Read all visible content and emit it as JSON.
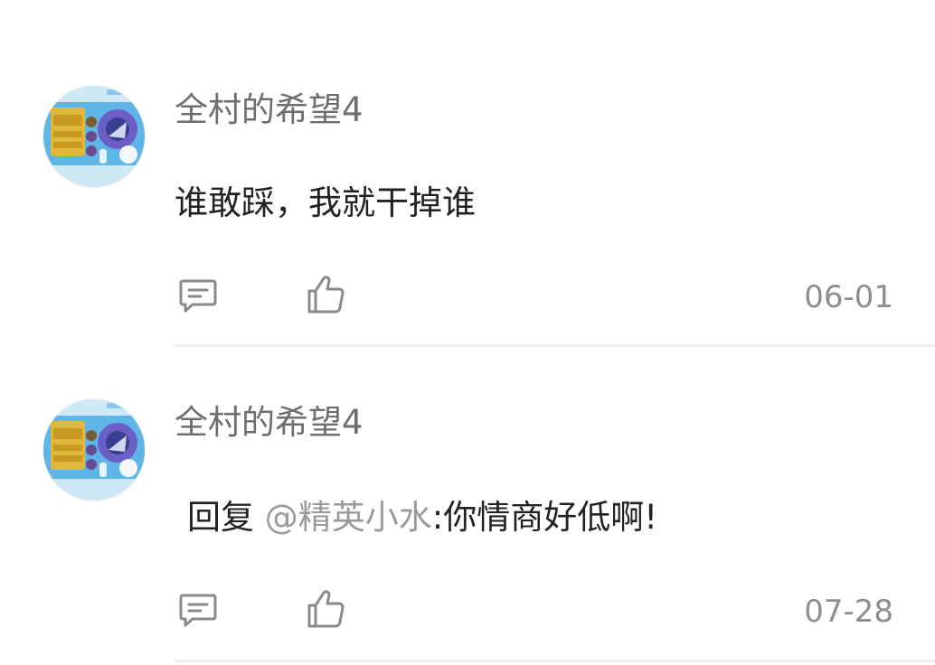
{
  "comments": [
    {
      "username": "全村的希望4",
      "text": "谁敢踩，我就干掉谁",
      "date": "06-01",
      "avatar_icon": "game-screenshot-avatar"
    },
    {
      "username": "全村的希望4",
      "reply_prefix": "回复",
      "mention": "@精英小水",
      "text": ":你情商好低啊!",
      "date": "07-28",
      "avatar_icon": "game-screenshot-avatar"
    }
  ],
  "icons": {
    "reply": "comment-bubble-icon",
    "like": "thumbs-up-icon"
  },
  "colors": {
    "username": "#6e6e6e",
    "text": "#222222",
    "mention": "#9a9a9a",
    "date": "#8e8e8e",
    "icon": "#8a8a8a",
    "divider": "#efefef"
  }
}
